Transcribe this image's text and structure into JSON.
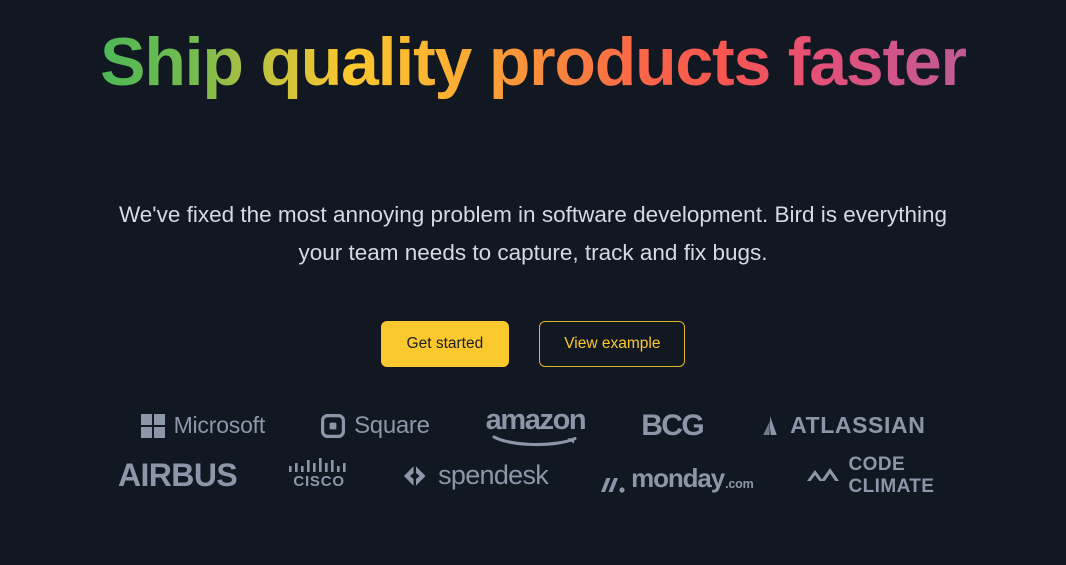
{
  "hero": {
    "headline": "Ship quality products faster",
    "subtitle": "We've fixed the most annoying problem in software development. Bird is everything your team needs to capture, track and fix bugs.",
    "primary_cta": "Get started",
    "secondary_cta": "View example"
  },
  "colors": {
    "background": "#121821",
    "accent_yellow": "#FBC82E",
    "logo_gray": "#8d96a8",
    "subtitle_gray": "#d4d9e2",
    "gradient_start": "#4DB757",
    "gradient_mid_yellow": "#FBC82E",
    "gradient_mid_orange": "#F8853E",
    "gradient_mid_red": "#F8564F",
    "gradient_end": "#C05B95"
  },
  "logos": {
    "row1": [
      {
        "name": "Microsoft",
        "icon": "microsoft-squares-icon"
      },
      {
        "name": "Square",
        "icon": "square-logo-icon"
      },
      {
        "name": "amazon",
        "icon": "amazon-swoosh-icon"
      },
      {
        "name": "BCG",
        "icon": "none"
      },
      {
        "name": "ATLASSIAN",
        "icon": "atlassian-a-icon"
      }
    ],
    "row2": [
      {
        "name": "AIRBUS",
        "icon": "none"
      },
      {
        "name": "CISCO",
        "icon": "cisco-bars-icon"
      },
      {
        "name": "spendesk",
        "icon": "spendesk-chevrons-icon"
      },
      {
        "name": "monday",
        "tld": ".com",
        "icon": "monday-slashes-icon"
      },
      {
        "name": "CODE CLIMATE",
        "icon": "code-climate-mountains-icon"
      }
    ]
  }
}
